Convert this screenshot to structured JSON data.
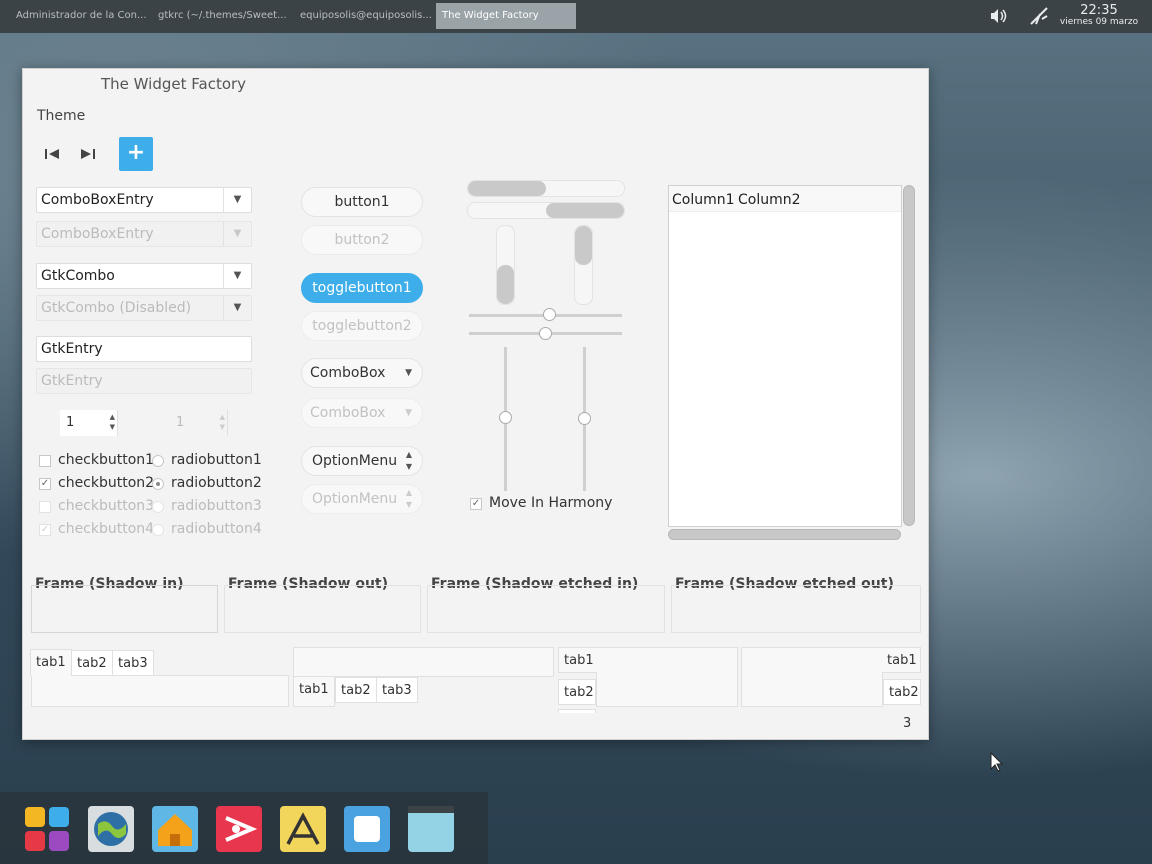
{
  "panel": {
    "tasks": [
      {
        "label": "Administrador de la Con..."
      },
      {
        "label": "gtkrc (~/.themes/Sweet..."
      },
      {
        "label": "equiposolis@equiposolis..."
      },
      {
        "label": "The Widget Factory"
      }
    ],
    "time": "22:35",
    "date": "viernes 09 marzo",
    "volume_icon": "speaker-icon",
    "network_icon": "network-icon"
  },
  "window": {
    "title": "The Widget Factory",
    "menu": {
      "theme": "Theme"
    },
    "toolbar": {
      "first_icon": "first-icon",
      "last_icon": "last-icon",
      "add_label": "+"
    },
    "left": {
      "combo_entry": "ComboBoxEntry",
      "combo_entry_disabled": "ComboBoxEntry",
      "gtk_combo": "GtkCombo",
      "gtk_combo_disabled": "GtkCombo (Disabled)",
      "entry": "GtkEntry",
      "entry_disabled_placeholder": "GtkEntry",
      "spin_value": "1",
      "spin_disabled_value": "1",
      "checks": [
        {
          "label": "checkbutton1",
          "checked": false,
          "disabled": false
        },
        {
          "label": "checkbutton2",
          "checked": true,
          "disabled": false
        },
        {
          "label": "checkbutton3",
          "checked": false,
          "disabled": true
        },
        {
          "label": "checkbutton4",
          "checked": true,
          "disabled": true
        }
      ],
      "radios": [
        {
          "label": "radiobutton1",
          "selected": false,
          "disabled": false
        },
        {
          "label": "radiobutton2",
          "selected": true,
          "disabled": false
        },
        {
          "label": "radiobutton3",
          "selected": false,
          "disabled": true
        },
        {
          "label": "radiobutton4",
          "selected": false,
          "disabled": true
        }
      ]
    },
    "middle": {
      "button1": "button1",
      "button2": "button2",
      "toggle1": "togglebutton1",
      "toggle2": "togglebutton2",
      "combobox": "ComboBox",
      "combobox_disabled": "ComboBox",
      "option_menu": "OptionMenu",
      "option_menu_disabled": "OptionMenu"
    },
    "sliders": {
      "move_in_harmony": "Move In Harmony",
      "move_in_harmony_checked": true,
      "hslider1_value": 0.5,
      "hslider2_value": 0.5,
      "vslider1_value": 0.5,
      "vslider2_value": 0.5
    },
    "tree": {
      "columns": [
        "Column1",
        "Column2"
      ]
    },
    "frames": {
      "in": "Frame (Shadow in)",
      "out": "Frame (Shadow out)",
      "etched_in": "Frame (Shadow etched in)",
      "etched_out": "Frame (Shadow etched out)"
    },
    "notebooks": {
      "tabs": [
        "tab1",
        "tab2",
        "tab3"
      ],
      "partial_tab": "3"
    }
  },
  "dock": {
    "items": [
      {
        "icon": "apps-grid-icon"
      },
      {
        "icon": "browser-globe-icon"
      },
      {
        "icon": "home-folder-icon"
      },
      {
        "icon": "media-player-icon"
      },
      {
        "icon": "text-editor-icon"
      },
      {
        "icon": "window-manager-icon"
      },
      {
        "icon": "desktop-icon"
      }
    ]
  }
}
